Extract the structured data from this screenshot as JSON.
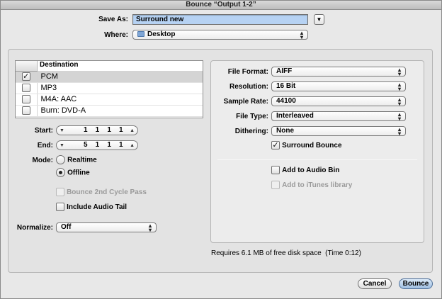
{
  "window": {
    "title": "Bounce “Output 1-2”"
  },
  "save_as": {
    "label": "Save As:",
    "value": "Surround new"
  },
  "where": {
    "label": "Where:",
    "value": "Desktop",
    "icon": "folder-icon"
  },
  "destination": {
    "header": "Destination",
    "rows": [
      {
        "name": "PCM",
        "checked": true
      },
      {
        "name": "MP3",
        "checked": false
      },
      {
        "name": "M4A: AAC",
        "checked": false
      },
      {
        "name": "Burn: DVD-A",
        "checked": false
      }
    ]
  },
  "start": {
    "label": "Start:",
    "value": "1    1    1    1"
  },
  "end": {
    "label": "End:",
    "value": "5    1    1    1"
  },
  "mode": {
    "label": "Mode:",
    "realtime": "Realtime",
    "offline": "Offline",
    "selected": "Offline"
  },
  "bounce_2nd": {
    "label": "Bounce 2nd Cycle Pass",
    "enabled": false,
    "checked": false
  },
  "include_tail": {
    "label": "Include Audio Tail",
    "checked": false
  },
  "normalize": {
    "label": "Normalize:",
    "value": "Off"
  },
  "file_format": {
    "label": "File Format:",
    "value": "AIFF"
  },
  "resolution": {
    "label": "Resolution:",
    "value": "16 Bit"
  },
  "sample_rate": {
    "label": "Sample Rate:",
    "value": "44100"
  },
  "file_type": {
    "label": "File Type:",
    "value": "Interleaved"
  },
  "dithering": {
    "label": "Dithering:",
    "value": "None"
  },
  "surround_bounce": {
    "label": "Surround Bounce",
    "checked": true
  },
  "add_audio_bin": {
    "label": "Add to Audio Bin",
    "checked": false
  },
  "add_itunes": {
    "label": "Add to iTunes library",
    "enabled": false
  },
  "status": {
    "text": "Requires 6.1 MB of free disk space  (Time 0:12)"
  },
  "buttons": {
    "cancel": "Cancel",
    "bounce": "Bounce"
  }
}
